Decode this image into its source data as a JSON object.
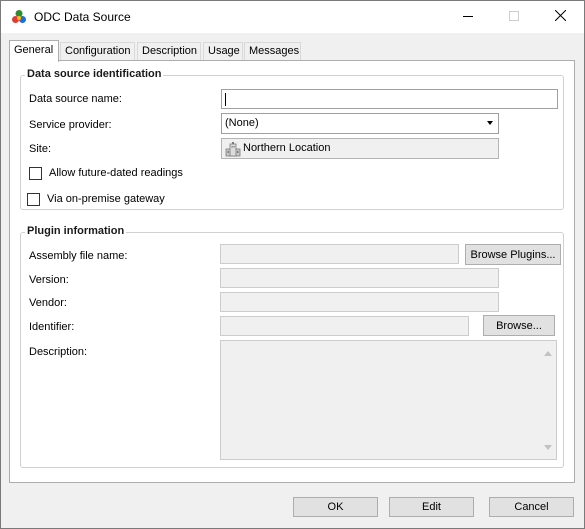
{
  "window": {
    "title": "ODC Data Source"
  },
  "tabs": [
    {
      "label": "General"
    },
    {
      "label": "Configuration"
    },
    {
      "label": "Description"
    },
    {
      "label": "Usage"
    },
    {
      "label": "Messages"
    }
  ],
  "identification": {
    "group_title": "Data source identification",
    "name_label": "Data source name:",
    "name_value": "",
    "provider_label": "Service provider:",
    "provider_value": "(None)",
    "site_label": "Site:",
    "site_value": "Northern Location",
    "future_dated_label": "Allow future-dated readings",
    "future_dated_checked": false,
    "gateway_label": "Via on-premise gateway",
    "gateway_checked": false
  },
  "plugin": {
    "group_title": "Plugin information",
    "assembly_label": "Assembly file name:",
    "assembly_value": "",
    "browse_plugins_label": "Browse Plugins...",
    "version_label": "Version:",
    "version_value": "",
    "vendor_label": "Vendor:",
    "vendor_value": "",
    "identifier_label": "Identifier:",
    "identifier_value": "",
    "browse_label": "Browse...",
    "description_label": "Description:",
    "description_value": ""
  },
  "footer": {
    "ok_label": "OK",
    "edit_label": "Edit",
    "cancel_label": "Cancel"
  },
  "icons": {
    "app": "odc-app-icon",
    "site": "building-icon"
  }
}
